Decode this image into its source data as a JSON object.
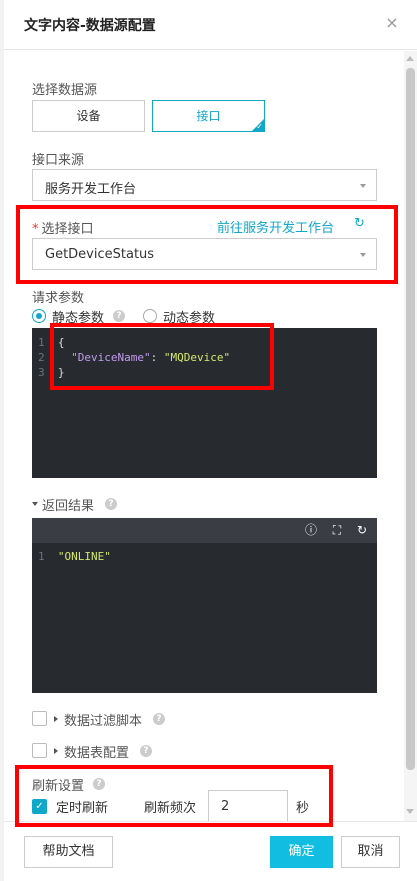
{
  "dialog": {
    "title": "文字内容-数据源配置",
    "close": "×"
  },
  "datasource": {
    "label": "选择数据源",
    "options": [
      "设备",
      "接口"
    ],
    "selected": "接口"
  },
  "api_source": {
    "label": "接口来源",
    "value": "服务开发工作台"
  },
  "api_select": {
    "required_mark": "*",
    "label": "选择接口",
    "link": "前往服务开发工作台",
    "value": "GetDeviceStatus"
  },
  "request_params": {
    "label": "请求参数",
    "static_label": "静态参数",
    "dynamic_label": "动态参数",
    "selected": "静态参数",
    "code": {
      "line_numbers": [
        "1",
        "2",
        "3"
      ],
      "open_brace": "{",
      "key": "\"DeviceName\"",
      "colon": ": ",
      "value": "\"MQDevice\"",
      "close_brace": "}"
    }
  },
  "result": {
    "label": "返回结果",
    "toolbar_icons": [
      "info-icon",
      "fullscreen-icon",
      "refresh-icon"
    ],
    "code": {
      "line_number": "1",
      "value": "\"ONLINE\""
    }
  },
  "filter_script": {
    "label": "数据过滤脚本",
    "checked": false
  },
  "table_config": {
    "label": "数据表配置",
    "checked": false
  },
  "refresh": {
    "section_label": "刷新设置",
    "timed_label": "定时刷新",
    "timed_checked": true,
    "freq_label": "刷新频次",
    "freq_value": "2",
    "unit": "秒"
  },
  "footer": {
    "help": "帮助文档",
    "confirm": "确定",
    "cancel": "取消"
  },
  "colors": {
    "accent": "#11a7c8",
    "primary_button": "#11bde0",
    "highlight": "#ff0000",
    "code_bg": "#272b30"
  }
}
